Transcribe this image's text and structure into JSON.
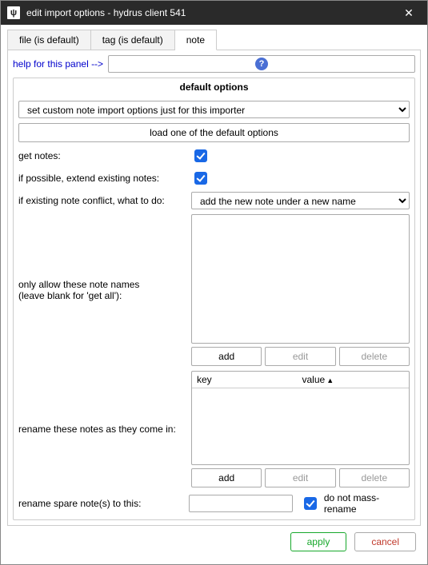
{
  "window": {
    "title": "edit import options - hydrus client 541"
  },
  "tabs": [
    {
      "label": "file (is default)"
    },
    {
      "label": "tag (is default)"
    },
    {
      "label": "note"
    }
  ],
  "active_tab": 2,
  "help": {
    "link_text": "help for this panel -->"
  },
  "defaults": {
    "legend": "default options",
    "preset_select": "set custom note import options just for this importer",
    "load_button": "load one of the default options"
  },
  "get_notes": {
    "label": "get notes:",
    "checked": true
  },
  "extend_existing": {
    "label": "if possible, extend existing notes:",
    "checked": true
  },
  "conflict": {
    "label": "if existing note conflict, what to do:",
    "value": "add the new note under a new name"
  },
  "allow_names": {
    "label_l1": "only allow these note names",
    "label_l2": "(leave blank for 'get all'):",
    "add": "add",
    "edit": "edit",
    "delete": "delete"
  },
  "rename_map": {
    "label": "rename these notes as they come in:",
    "col_key": "key",
    "col_value": "value",
    "add": "add",
    "edit": "edit",
    "delete": "delete"
  },
  "spare": {
    "label": "rename spare note(s) to this:",
    "value": "",
    "no_mass_rename_label": "do not mass-rename",
    "no_mass_rename_checked": true
  },
  "footer": {
    "apply": "apply",
    "cancel": "cancel"
  }
}
